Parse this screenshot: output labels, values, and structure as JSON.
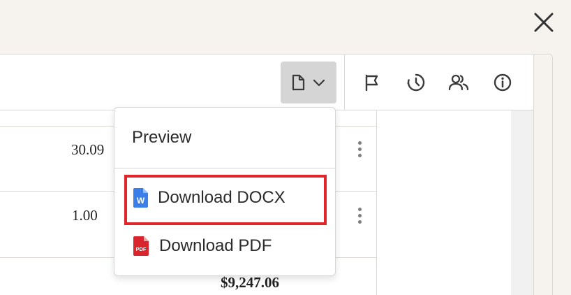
{
  "window": {
    "close_icon": "close-icon"
  },
  "toolbar": {
    "document_menu_icon": "document-icon",
    "document_menu_chevron": "chevron-down-icon",
    "tools": [
      "flag-icon",
      "history-icon",
      "users-icon",
      "info-icon"
    ]
  },
  "table": {
    "rows": [
      {
        "value": "30.09"
      },
      {
        "value": "1.00"
      }
    ],
    "total": "$9,247.06"
  },
  "dropdown": {
    "items": [
      {
        "label": "Preview"
      },
      {
        "label": "Download DOCX",
        "icon": "word-file-icon",
        "icon_letter": "W"
      },
      {
        "label": "Download PDF",
        "icon": "pdf-file-icon",
        "icon_text": "PDF"
      }
    ]
  },
  "colors": {
    "page_background": "#f6f3ee",
    "highlight": "#e0262b",
    "word_blue": "#3a7ee8",
    "pdf_red": "#d9252c",
    "icon_gray": "#4a4a4a"
  }
}
